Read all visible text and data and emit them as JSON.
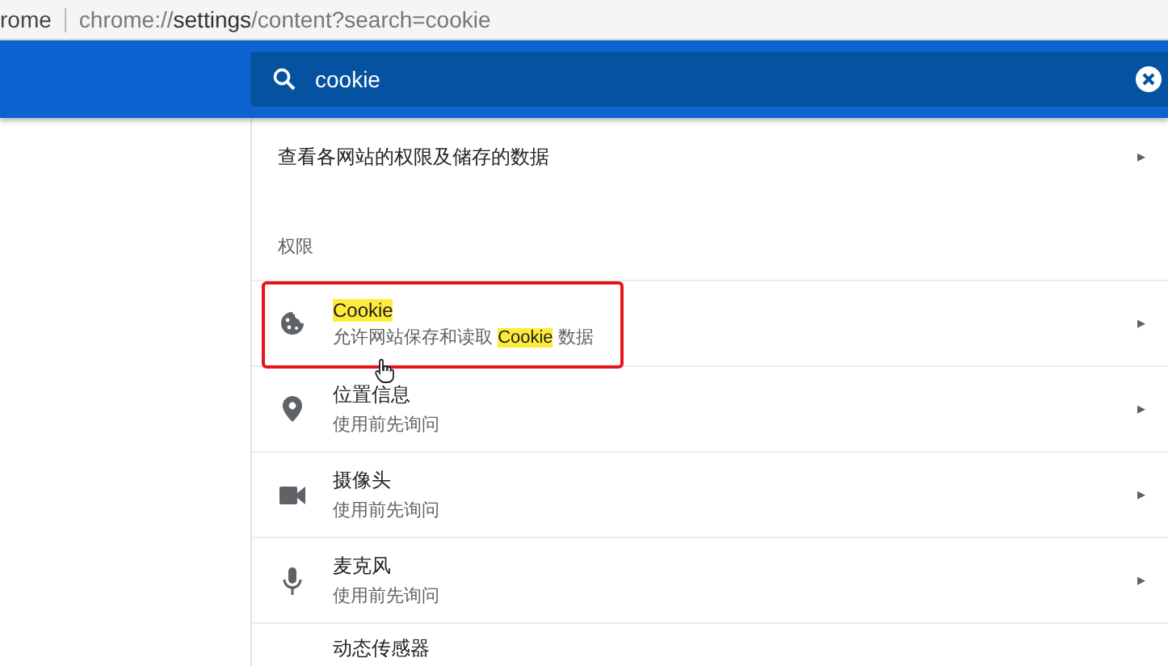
{
  "address_bar": {
    "tab_label": "rome",
    "url_parts": [
      {
        "text": "chrome://",
        "emphasis": false
      },
      {
        "text": "settings",
        "emphasis": true
      },
      {
        "text": "/content?search=cookie",
        "emphasis": false
      }
    ]
  },
  "search": {
    "value": "cookie"
  },
  "site_data_link": {
    "label": "查看各网站的权限及储存的数据",
    "arrow": "▸"
  },
  "section": {
    "title": "权限"
  },
  "rows": [
    {
      "title": [
        {
          "text": "Cookie",
          "match": true
        }
      ],
      "subtitle": [
        {
          "text": "允许网站保存和读取 ",
          "match": false
        },
        {
          "text": "Cookie",
          "match": true
        },
        {
          "text": " 数据",
          "match": false
        }
      ],
      "arrow": "▸",
      "outlined": true,
      "hovered": true
    },
    {
      "title": [
        {
          "text": "位置信息",
          "match": false
        }
      ],
      "subtitle": [
        {
          "text": "使用前先询问",
          "match": false
        }
      ],
      "arrow": "▸",
      "outlined": false,
      "hovered": false
    },
    {
      "title": [
        {
          "text": "摄像头",
          "match": false
        }
      ],
      "subtitle": [
        {
          "text": "使用前先询问",
          "match": false
        }
      ],
      "arrow": "▸",
      "outlined": false,
      "hovered": false
    },
    {
      "title": [
        {
          "text": "麦克风",
          "match": false
        }
      ],
      "subtitle": [
        {
          "text": "使用前先询问",
          "match": false
        }
      ],
      "arrow": "▸",
      "outlined": false,
      "hovered": false
    },
    {
      "title": [
        {
          "text": "动态传感器",
          "match": false
        }
      ],
      "subtitle": [],
      "arrow": "",
      "outlined": false,
      "hovered": false
    }
  ]
}
